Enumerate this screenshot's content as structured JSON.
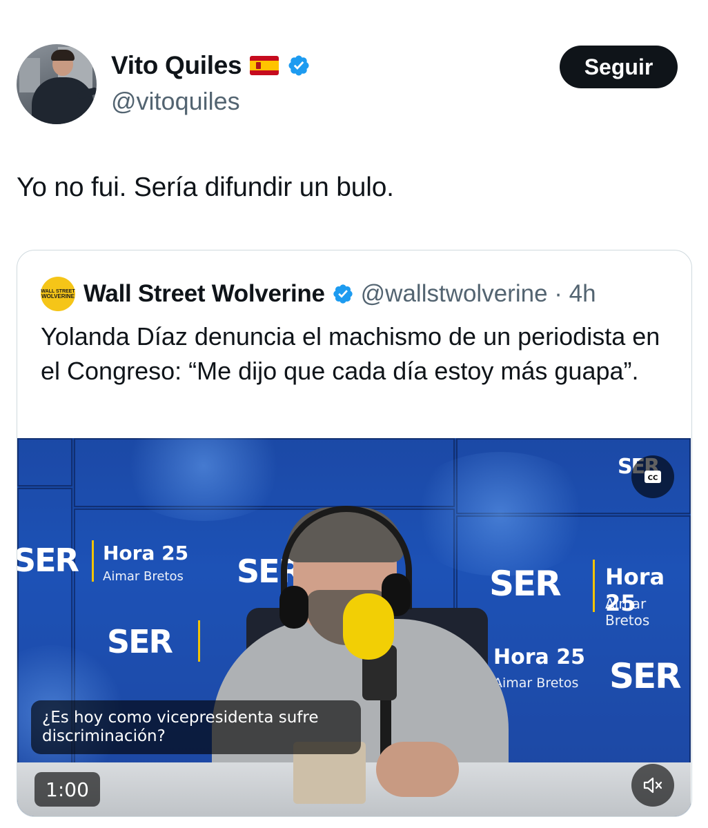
{
  "author": {
    "display_name": "Vito Quiles",
    "handle": "@vitoquiles",
    "flag": "spain-flag",
    "verified": true
  },
  "follow_label": "Seguir",
  "tweet_text": "Yo no fui. Sería difundir un bulo.",
  "quoted": {
    "logo_text_top": "WALL STREET",
    "logo_text_bottom": "WOLVERINE",
    "display_name": "Wall Street Wolverine",
    "handle_time": "@wallstwolverine · 4h",
    "verified": true,
    "text": "Yolanda Díaz denuncia el machismo de un periodista en el Congreso: “Me dijo que cada día estoy más guapa”."
  },
  "video": {
    "caption": "¿Es hoy como vicepresidenta sufre discriminación?",
    "duration": "1:00",
    "cc_icon": "closed-captions-icon",
    "mute_icon": "speaker-muted-icon",
    "background_text": {
      "brand": "SER",
      "program": "Hora 25",
      "host": "Aimar Bretos"
    }
  },
  "colors": {
    "text_primary": "#0f1419",
    "text_secondary": "#536471",
    "verified_blue": "#1d9bf0",
    "button_bg": "#0f1419",
    "border": "#cfd9de",
    "ser_yellow": "#f2c300"
  }
}
